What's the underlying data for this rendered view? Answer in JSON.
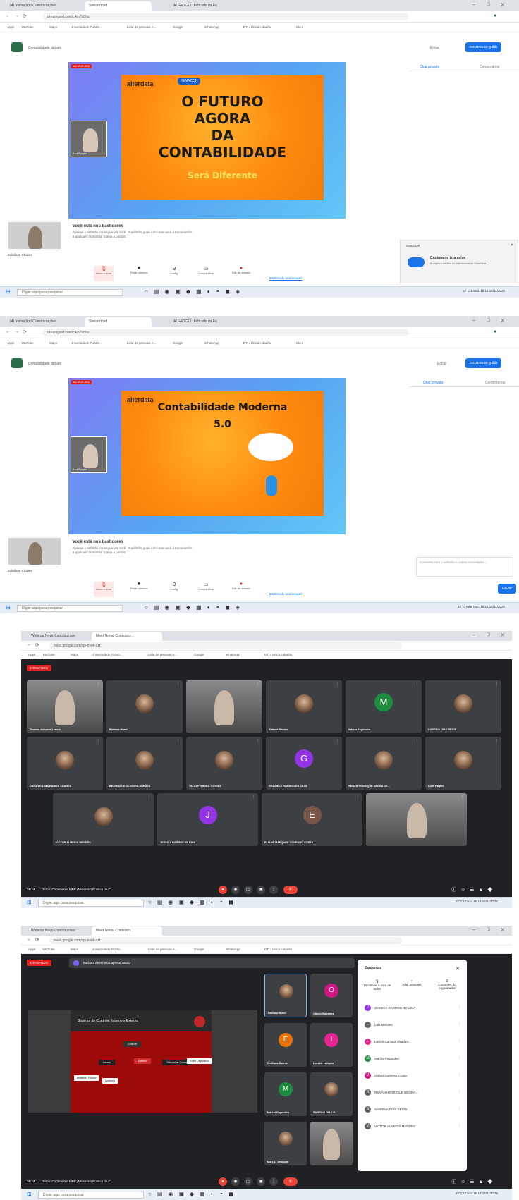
{
  "colors": {
    "accent": "#1a73e8",
    "danger": "#d93025",
    "meet_bg": "#202124",
    "tile_bg": "#3c4043",
    "slide_orange": "#ff8a10",
    "stage_purple": "#7f7cf5"
  },
  "screen1": {
    "tabs": [
      "(4) Instrução / Considerações",
      "StreamYard",
      "ALFADIGI / Unificado da Fo..."
    ],
    "url": "streamyard.com/c4m7b8hu",
    "bookmarks": [
      "Apps",
      "YouTube",
      "Maps",
      "Universidade FUND...",
      "Lista de pessoas e...",
      "Google",
      "WhatsApp",
      "ETI / Unica cidadão",
      "Moni"
    ],
    "app_title": "Contabilidade debate",
    "header_btn_text": "Editar",
    "header_btn_primary": "Inscreva-se grátis",
    "side_tabs": [
      "Chat privado",
      "Comentários"
    ],
    "badge": "AO VIVO 2022",
    "brand": "alterdata",
    "brand2": "FENACON",
    "slide_lines": [
      "O FUTURO",
      "AGORA",
      "DA",
      "CONTABILIDADE"
    ],
    "slide_sub": "Será Diferente",
    "host_cam_label": "Sara Borges",
    "backstage_title": "Você está nos bastidores",
    "backstage_text": "Apenas o anfitrião consegue ver você. O anfitrião pode adicionar você à transmissão a qualquer momento. Esteja à postos!",
    "self_label": "Edinilson Chaves",
    "controls": [
      "Ativar o som",
      "Parar câmera",
      "Config.",
      "Compartilhar",
      "Sair do estúdio"
    ],
    "help_link": "Está tendo problemas?",
    "toast_header": "OneDrive",
    "toast_title": "Captura de tela salva",
    "toast_body": "A captura de tela foi adicionada ao OneDrive.",
    "taskbar_search": "Digite aqui para pesquisar",
    "tray": "27°C Ensol. 16:14 15/11/2022"
  },
  "screen2": {
    "tabs": [
      "(4) Instrução / Considerações",
      "StreamYard",
      "ALFADIGI / Unificado da Fo..."
    ],
    "url": "streamyard.com/c4m7b8hu",
    "app_title": "Contabilidade debate",
    "header_btn_text": "Editar",
    "header_btn_primary": "Inscreva-se grátis",
    "side_tabs": [
      "Chat privado",
      "Comentários"
    ],
    "badge": "AO VIVO 2022",
    "brand": "alterdata",
    "slide_title": "Contabilidade Moderna",
    "slide_sub": "5.0",
    "host_cam_label": "Sara Borges",
    "backstage_title": "Você está nos bastidores",
    "backstage_text": "Apenas o anfitrião consegue ver você. O anfitrião pode adicionar você à transmissão a qualquer momento. Esteja à postos!",
    "self_label": "Edinilson Chaves",
    "controls": [
      "Ativar o som",
      "Parar câmera",
      "Config.",
      "Compartilhar",
      "Sair do estúdio"
    ],
    "help_link": "Está tendo problemas?",
    "chat_placeholder": "Converse com o anfitrião e outros convidados...",
    "send_btn": "Enviar",
    "taskbar_search": "Digite aqui para pesquisar",
    "tray": "27°C Real Imp. 16:21 15/11/2022"
  },
  "screen3": {
    "tabs": [
      "Webinar Novo Contribuintes",
      "Meet Tema: Conteúdo..."
    ],
    "url": "meet.google.com/xjn-nyxh-sxt",
    "rec_badge": "GRAVANDO",
    "participants": [
      [
        "Thomaz Antunes Lemos",
        "video"
      ],
      [
        "Bárbara Murel",
        "photo"
      ],
      [
        "",
        "video"
      ],
      [
        "Rafaela Santos",
        "photo"
      ],
      [
        "Márcio Fagundes",
        "M"
      ],
      [
        "SABRINA DIAS REGIS",
        "photo"
      ],
      [
        "DANIELE LIMA RAMOS SOARES",
        "photo"
      ],
      [
        "BEATRIZ DE OLIVEIRA DURÃES",
        "photo"
      ],
      [
        "TALIO PEREIRA TORRES",
        "photo"
      ],
      [
        "GRAZIELE RODRIGUES SILVA",
        "G"
      ],
      [
        "RENAN HENRIQUE NEGRA DE...",
        "photo"
      ],
      [
        "Luan Paganí",
        "photo"
      ],
      [
        "VICTOR ALMEIDA MENDES",
        "photo"
      ],
      [
        "JESSICA BARROS DE LIMA",
        "J"
      ],
      [
        "ELIANE MARQUES CONRADO COSTA",
        "E"
      ],
      [
        "",
        "video"
      ]
    ],
    "meeting_time": "16:14",
    "meeting_title": "Tema: Conteúdo e MPC (Ministério Público de C...",
    "taskbar_search": "Digite aqui para pesquisar",
    "tray": "24°C Chuva 16:14 15/11/2022"
  },
  "screen4": {
    "tabs": [
      "Webinar Novo Contribuintes",
      "Meet Tema: Conteúdo..."
    ],
    "url": "meet.google.com/xjn-nyxh-sxt",
    "rec_badge": "GRAVANDO",
    "presenting": "Barbara Murel está apresentando",
    "slide_title": "Sistema de Controle: Interno x Externo",
    "slide_boxes": [
      "Controle",
      "Interno",
      "Externo",
      "Tribunal de Contas",
      "Poder Legislativo",
      "Ministério Público",
      "Auditoria"
    ],
    "side_tiles": [
      [
        "Barbara Murel",
        "photo"
      ],
      [
        "Otávio Gutierrez",
        "O"
      ],
      [
        "Emiliana Barros",
        "E"
      ],
      [
        "Lucenir campos",
        "I"
      ],
      [
        "Márcio Fagundes",
        "M"
      ],
      [
        "SABRINA DIAS R...",
        "photo"
      ],
      [
        "Mais 11 pessoas",
        "photo"
      ],
      [
        "",
        "video"
      ]
    ],
    "people_title": "Pessoas",
    "people_actions": [
      "Desativar o som de todos",
      "Add. pessoas",
      "Controles do organizador"
    ],
    "people": [
      [
        "JESSICA BARROS DE LIMA",
        "#9334e6"
      ],
      [
        "Lala Mendes",
        "#5f6368"
      ],
      [
        "Lucinir Camara Valadan...",
        "#e52592"
      ],
      [
        "Márcio Fagundes",
        "#1e8e3e"
      ],
      [
        "Otávio Gutierrez Costa",
        "#d01884"
      ],
      [
        "RENAN HENRIQUE NEGRA...",
        "#5f6368"
      ],
      [
        "SABRINA DIAS REGIS",
        "#5f6368"
      ],
      [
        "VICTOR ALMEIDA MENDES",
        "#5f6368"
      ]
    ],
    "meeting_time": "16:14",
    "meeting_title": "Tema: Conteúdo e MPC (Ministério Público de C...",
    "taskbar_search": "Digite aqui para pesquisar",
    "tray": "24°C Chuva 16:19 15/11/2022"
  }
}
